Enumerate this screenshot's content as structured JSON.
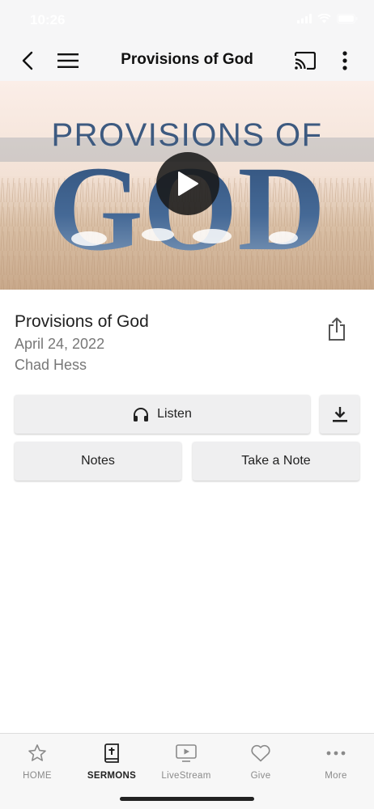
{
  "status_bar": {
    "time": "10:26"
  },
  "nav": {
    "title": "Provisions of God"
  },
  "hero": {
    "line1": "PROVISIONS OF",
    "line2": "GOD"
  },
  "sermon": {
    "title": "Provisions of God",
    "date": "April 24, 2022",
    "speaker": "Chad Hess"
  },
  "actions": {
    "listen_label": "Listen",
    "notes_label": "Notes",
    "take_note_label": "Take a Note"
  },
  "tabs": [
    {
      "label": "HOME",
      "icon": "star-icon",
      "active": false
    },
    {
      "label": "SERMONS",
      "icon": "bible-icon",
      "active": true
    },
    {
      "label": "LiveStream",
      "icon": "video-play-icon",
      "active": false
    },
    {
      "label": "Give",
      "icon": "heart-icon",
      "active": false
    },
    {
      "label": "More",
      "icon": "ellipsis-icon",
      "active": false
    }
  ],
  "colors": {
    "hero_text": "#3d5a80",
    "tab_active": "#222222",
    "tab_inactive": "#8a8a8a",
    "button_bg": "#efeff0"
  }
}
